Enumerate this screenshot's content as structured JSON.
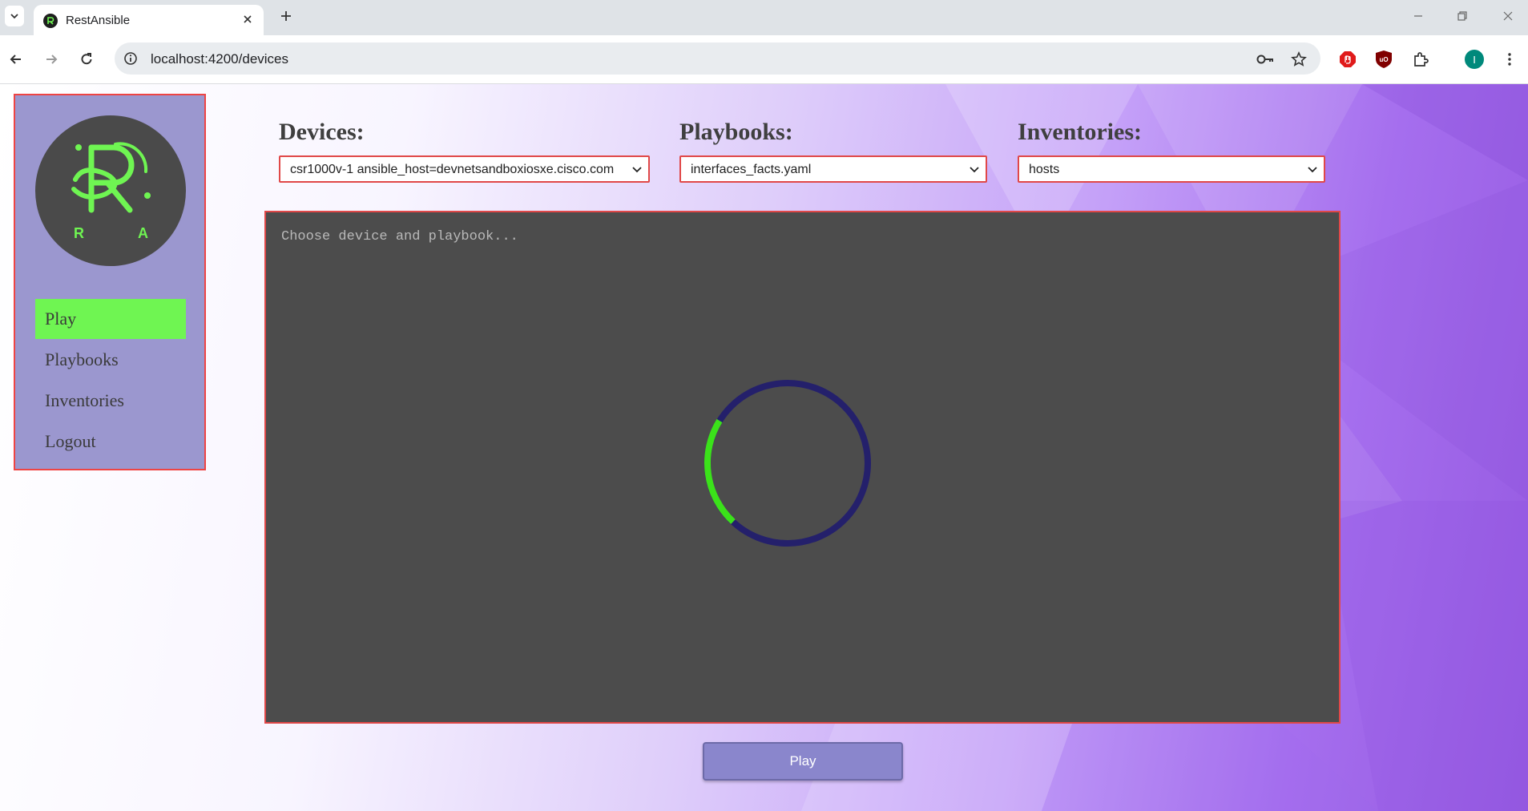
{
  "browser": {
    "tab_title": "RestAnsible",
    "url": "localhost:4200/devices",
    "profile_initial": "I"
  },
  "sidebar": {
    "logo_letters": [
      "R",
      "A"
    ],
    "items": [
      {
        "label": "Play",
        "active": true
      },
      {
        "label": "Playbooks",
        "active": false
      },
      {
        "label": "Inventories",
        "active": false
      },
      {
        "label": "Logout",
        "active": false
      }
    ]
  },
  "main": {
    "devices": {
      "label": "Devices:",
      "value": "csr1000v-1 ansible_host=devnetsandboxiosxe.cisco.com"
    },
    "playbooks": {
      "label": "Playbooks:",
      "value": "interfaces_facts.yaml"
    },
    "inventories": {
      "label": "Inventories:",
      "value": "hosts"
    },
    "console": {
      "placeholder": "Choose device and playbook..."
    },
    "play_button": "Play"
  },
  "colors": {
    "accent_green": "#6ff552",
    "sidebar_bg": "#9b97cf",
    "console_bg": "#4c4c4c",
    "border_red": "#e04848",
    "spinner_track": "#24206b",
    "spinner_arc": "#3be21a"
  }
}
